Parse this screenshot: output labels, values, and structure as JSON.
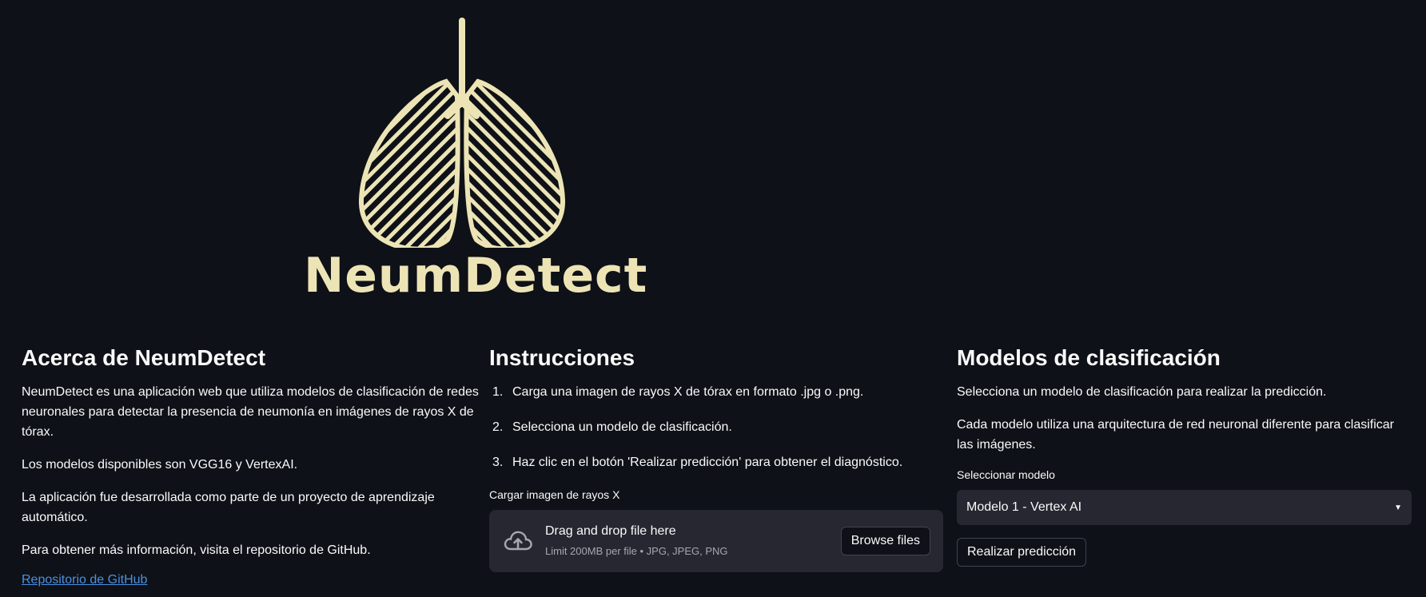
{
  "logo": {
    "wordmark": "NeumDetect",
    "icon": "lungs-icon",
    "color": "#ede4b6"
  },
  "about": {
    "title": "Acerca de NeumDetect",
    "paragraphs": [
      "NeumDetect es una aplicación web que utiliza modelos de clasificación de redes neuronales para detectar la presencia de neumonía en imágenes de rayos X de tórax.",
      "Los modelos disponibles son VGG16 y VertexAI.",
      "La aplicación fue desarrollada como parte de un proyecto de aprendizaje automático.",
      "Para obtener más información, visita el repositorio de GitHub."
    ],
    "link_label": "Repositorio de GitHub"
  },
  "instructions": {
    "title": "Instrucciones",
    "steps": [
      {
        "num": "1.",
        "text": "Carga una imagen de rayos X de tórax en formato .jpg o .png."
      },
      {
        "num": "2.",
        "text": "Selecciona un modelo de clasificación."
      },
      {
        "num": "3.",
        "text": "Haz clic en el botón 'Realizar predicción' para obtener el diagnóstico."
      }
    ],
    "uploader": {
      "label": "Cargar imagen de rayos X",
      "title": "Drag and drop file here",
      "subtitle": "Limit 200MB per file • JPG, JPEG, PNG",
      "button_label": "Browse files",
      "icon": "cloud-upload-icon"
    }
  },
  "models": {
    "title": "Modelos de clasificación",
    "paragraphs": [
      "Selecciona un modelo de clasificación para realizar la predicción.",
      "Cada modelo utiliza una arquitectura de red neuronal diferente para clasificar las imágenes."
    ],
    "select_label": "Seleccionar modelo",
    "select_value": "Modelo 1 - Vertex AI",
    "predict_label": "Realizar predicción"
  },
  "colors": {
    "background": "#0e1117",
    "surface": "#262730",
    "link": "#4a90e2"
  }
}
